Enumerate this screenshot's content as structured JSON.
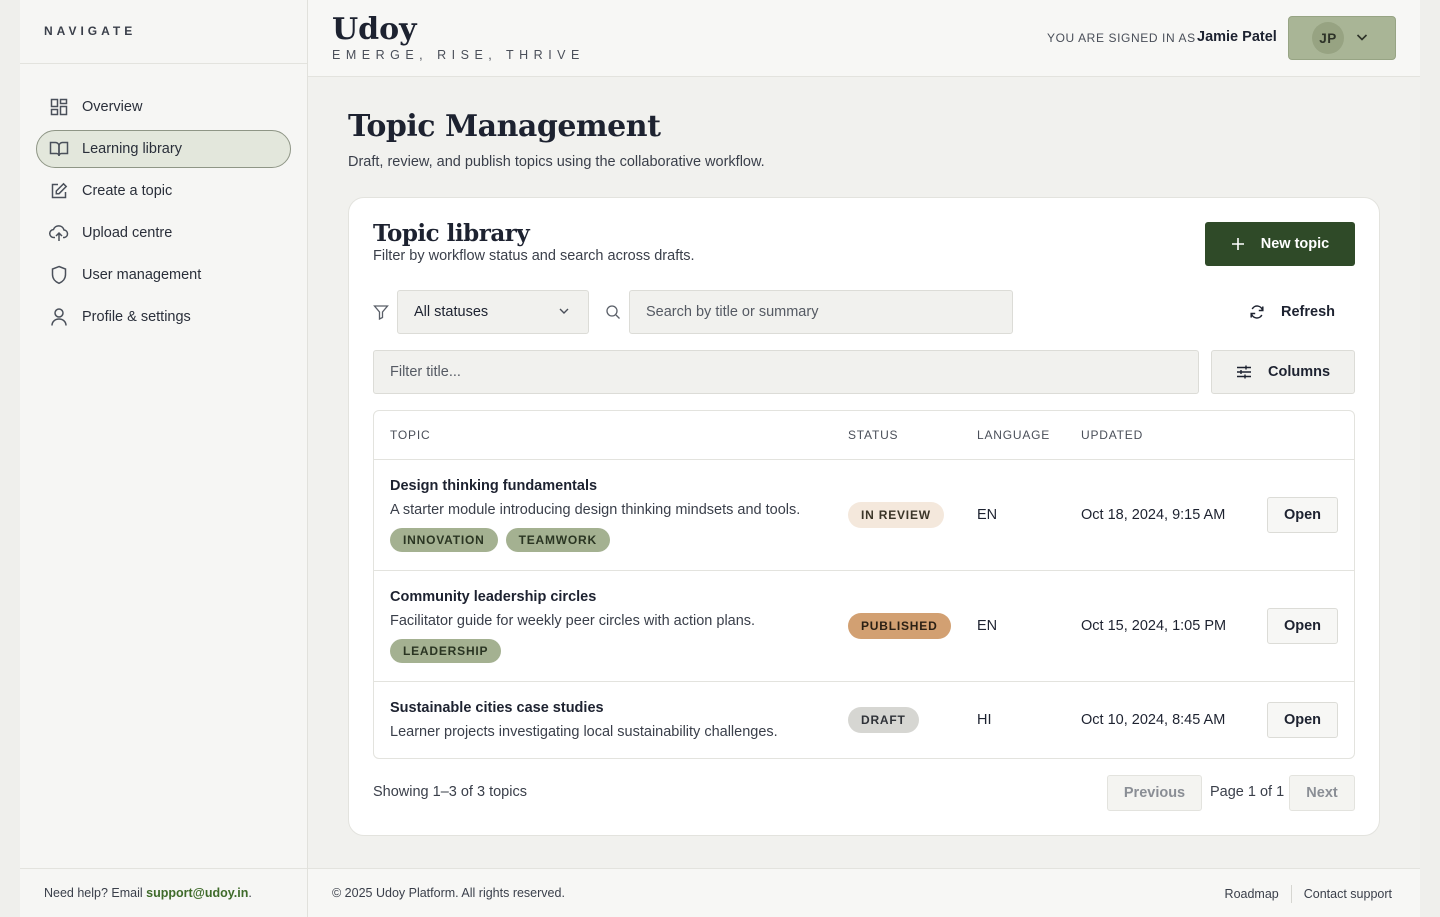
{
  "sidebar": {
    "heading": "NAVIGATE",
    "items": [
      {
        "label": "Overview",
        "icon": "grid-icon"
      },
      {
        "label": "Learning library",
        "icon": "book-icon",
        "active": true
      },
      {
        "label": "Create a topic",
        "icon": "edit-icon"
      },
      {
        "label": "Upload centre",
        "icon": "cloud-upload-icon"
      },
      {
        "label": "User management",
        "icon": "shield-icon"
      },
      {
        "label": "Profile & settings",
        "icon": "user-icon"
      }
    ],
    "help_prefix": "Need help? Email ",
    "help_email": "support@udoy.in",
    "help_suffix": "."
  },
  "header": {
    "brand": "Udoy",
    "tagline": "EMERGE, RISE, THRIVE",
    "signed_in_label": "YOU ARE SIGNED IN AS",
    "user_name": "Jamie Patel",
    "user_initials": "JP"
  },
  "page": {
    "title": "Topic Management",
    "subtitle": "Draft, review, and publish topics using the collaborative workflow."
  },
  "library": {
    "title": "Topic library",
    "subtitle": "Filter by workflow status and search across drafts.",
    "new_button": "New topic",
    "status_filter": "All statuses",
    "search_placeholder": "Search by title or summary",
    "refresh_button": "Refresh",
    "title_filter_placeholder": "Filter title...",
    "columns_button": "Columns",
    "headers": [
      "TOPIC",
      "STATUS",
      "LANGUAGE",
      "UPDATED"
    ],
    "rows": [
      {
        "title": "Design thinking fundamentals",
        "summary": "A starter module introducing design thinking mindsets and tools.",
        "tags": [
          "INNOVATION",
          "TEAMWORK"
        ],
        "status": "IN REVIEW",
        "language": "EN",
        "updated": "Oct 18, 2024, 9:15 AM",
        "action": "Open"
      },
      {
        "title": "Community leadership circles",
        "summary": "Facilitator guide for weekly peer circles with action plans.",
        "tags": [
          "LEADERSHIP"
        ],
        "status": "PUBLISHED",
        "language": "EN",
        "updated": "Oct 15, 2024, 1:05 PM",
        "action": "Open"
      },
      {
        "title": "Sustainable cities case studies",
        "summary": "Learner projects investigating local sustainability challenges.",
        "tags": [],
        "status": "DRAFT",
        "language": "HI",
        "updated": "Oct 10, 2024, 8:45 AM",
        "action": "Open"
      }
    ],
    "showing": "Showing 1–3 of 3 topics",
    "previous": "Previous",
    "page_label": "Page 1 of 1",
    "next": "Next"
  },
  "footer": {
    "copyright": "© 2025 Udoy Platform. All rights reserved.",
    "links": [
      "Roadmap",
      "Contact support"
    ]
  },
  "colors": {
    "primary": "#2f4a28",
    "accent_sage": "#a9b596",
    "published": "#d2a072",
    "in_review": "#f4e8dc",
    "draft": "#d6d6d2"
  }
}
